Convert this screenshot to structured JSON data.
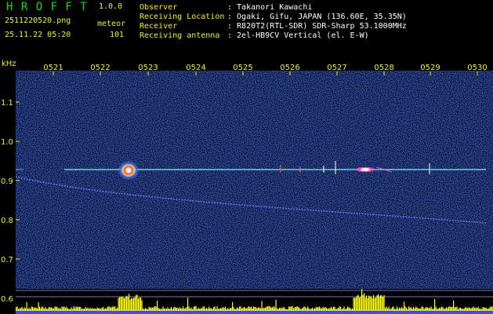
{
  "app": {
    "name": "H R O F F T",
    "version": "1.0.0"
  },
  "file": {
    "name": "2511220520.png",
    "datetime": "25.11.22 05:20"
  },
  "detection": {
    "label": "meteor",
    "count": "101"
  },
  "info": [
    {
      "key": "Observer",
      "value": ": Takanori Kawachi"
    },
    {
      "key": "Receiving Location",
      "value": ": Ogaki, Gifu, JAPAN (136.60E, 35.35N)"
    },
    {
      "key": "Receiver",
      "value": ": R820T2(RTL-SDR) SDR-Sharp 53.1000MHz"
    },
    {
      "key": "Receiving antenna",
      "value": ": 2el-HB9CV Vertical (el. E-W)"
    }
  ],
  "axes": {
    "y_unit": "kHz",
    "y_ticks": [
      "1.1",
      "1.0",
      "0.9",
      "0.8",
      "0.7",
      "0.6"
    ],
    "x_ticks": [
      "0521",
      "0522",
      "0523",
      "0524",
      "0525",
      "0526",
      "0527",
      "0528",
      "0529",
      "0530"
    ]
  },
  "colors": {
    "background": "#000000",
    "header_green": "#00e000",
    "header_yellow": "#f2f200",
    "noise_blue": "#1a2fa0",
    "carrier": "#5fe0ff",
    "meteor": "#ffffff",
    "baseline": "#3a4cff",
    "level_bars": "#ffff00"
  }
}
